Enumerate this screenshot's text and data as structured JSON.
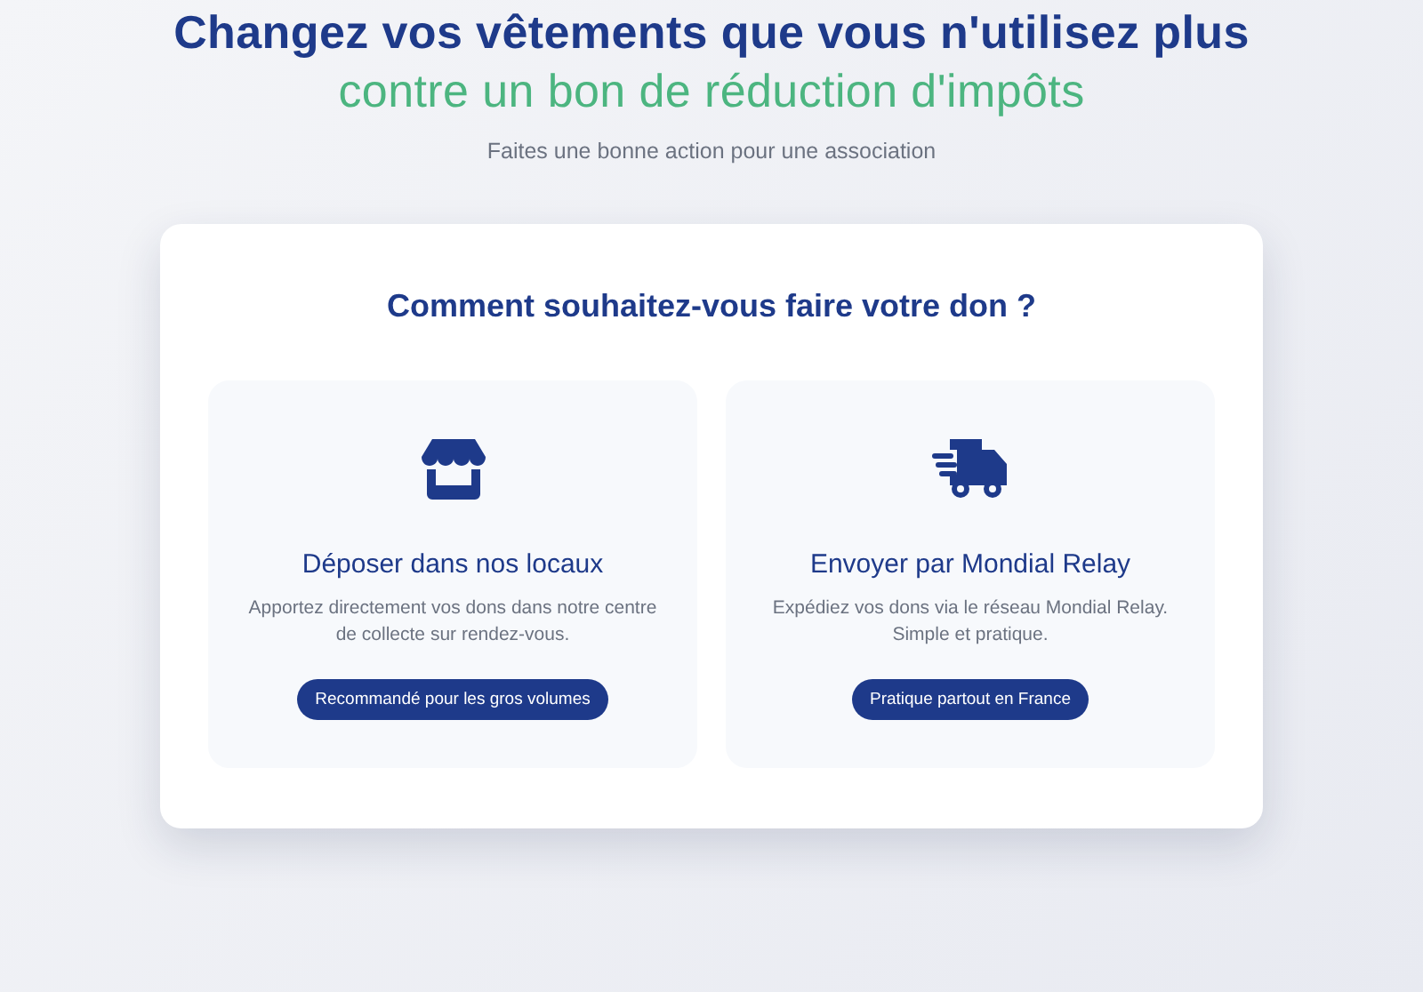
{
  "hero": {
    "title_line_1": "Changez vos vêtements que vous n'utilisez plus",
    "title_line_2": "contre un bon de réduction d'impôts",
    "subtitle": "Faites une bonne action pour une association"
  },
  "card": {
    "heading": "Comment souhaitez-vous faire votre don ?",
    "options": [
      {
        "kind": "store",
        "title": "Déposer dans nos locaux",
        "description": "Apportez directement vos dons dans notre centre de collecte sur rendez-vous.",
        "badge": "Recommandé pour les gros volumes"
      },
      {
        "kind": "truck",
        "title": "Envoyer par Mondial Relay",
        "description": "Expédiez vos dons via le réseau Mondial Relay. Simple et pratique.",
        "badge": "Pratique partout en France"
      }
    ]
  }
}
